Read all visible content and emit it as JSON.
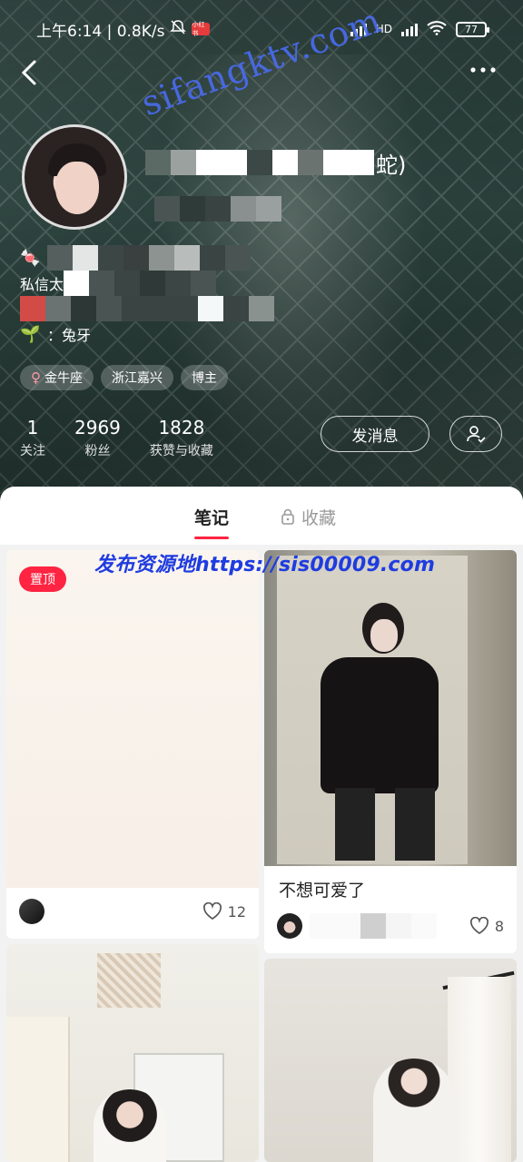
{
  "status_bar": {
    "time_speed": "上午6:14 | 0.8K/s",
    "app_badge": "小红书",
    "hd": "HD",
    "battery": "77"
  },
  "watermark_top": "sifangktv.com",
  "profile": {
    "name_tail": "蛇)",
    "bio_line2_prefix": "私信太",
    "bio_line4": "：兔牙",
    "tags": [
      {
        "label": "金牛座",
        "gender": "♀"
      },
      {
        "label": "浙江嘉兴"
      },
      {
        "label": "博主"
      }
    ],
    "stats": [
      {
        "num": "1",
        "label": "关注"
      },
      {
        "num": "2969",
        "label": "粉丝"
      },
      {
        "num": "1828",
        "label": "获赞与收藏"
      }
    ],
    "message_button": "发消息"
  },
  "tabs": {
    "notes": "笔记",
    "collections": "收藏"
  },
  "ad_banner": "发布资源地https://sis00009.com",
  "feed": [
    {
      "pin": "置顶",
      "likes": "12"
    },
    {
      "title": "不想可爱了",
      "likes": "8"
    },
    {},
    {}
  ],
  "colors": {
    "accent": "#ff2442",
    "watermark": "#4a6cf0",
    "ad_text": "#1f3ce0"
  },
  "icons": {
    "back": "chevron-left-icon",
    "more": "more-dots-icon",
    "follow": "user-check-icon",
    "lock": "lock-icon",
    "like": "heart-icon"
  }
}
